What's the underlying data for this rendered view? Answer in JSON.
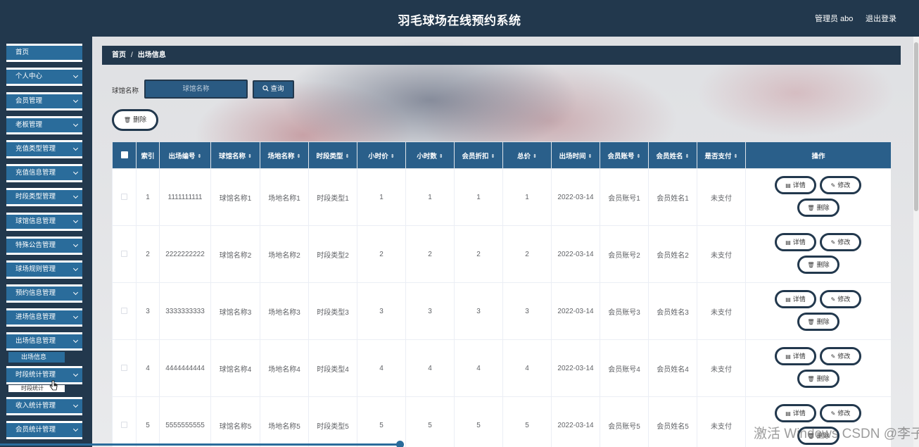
{
  "header": {
    "title": "羽毛球场在线预约系统",
    "admin": "管理员 abo",
    "logout": "退出登录"
  },
  "sidebar": {
    "items": [
      {
        "label": "首页",
        "chevron": false
      },
      {
        "label": "个人中心",
        "chevron": true
      },
      {
        "label": "会员管理",
        "chevron": true
      },
      {
        "label": "老板管理",
        "chevron": true
      },
      {
        "label": "充值类型管理",
        "chevron": true
      },
      {
        "label": "充值信息管理",
        "chevron": true
      },
      {
        "label": "时段类型管理",
        "chevron": true
      },
      {
        "label": "球馆信息管理",
        "chevron": true
      },
      {
        "label": "特殊公告管理",
        "chevron": true
      },
      {
        "label": "球场规则管理",
        "chevron": true
      },
      {
        "label": "预约信息管理",
        "chevron": true
      },
      {
        "label": "进场信息管理",
        "chevron": true
      },
      {
        "label": "出场信息管理",
        "chevron": true
      },
      {
        "label": "时段统计管理",
        "chevron": true
      },
      {
        "label": "收入统计管理",
        "chevron": true
      },
      {
        "label": "会员统计管理",
        "chevron": true
      }
    ],
    "submenu_active": "出场信息",
    "submenu_hover": "时段统计"
  },
  "breadcrumb": {
    "home": "首页",
    "separator": "/",
    "current": "出场信息"
  },
  "search": {
    "label": "球馆名称",
    "placeholder": "球馆名称",
    "query_label": "查询"
  },
  "toolbar": {
    "delete_label": "删除"
  },
  "table": {
    "headers": [
      "索引",
      "出场编号",
      "球馆名称",
      "场地名称",
      "时段类型",
      "小时价",
      "小时数",
      "会员折扣",
      "总价",
      "出场时间",
      "会员账号",
      "会员姓名",
      "是否支付",
      "操作"
    ],
    "rows": [
      [
        "1",
        "1111111111",
        "球馆名称1",
        "场地名称1",
        "时段类型1",
        "1",
        "1",
        "1",
        "1",
        "2022-03-14",
        "会员账号1",
        "会员姓名1",
        "未支付"
      ],
      [
        "2",
        "2222222222",
        "球馆名称2",
        "场地名称2",
        "时段类型2",
        "2",
        "2",
        "2",
        "2",
        "2022-03-14",
        "会员账号2",
        "会员姓名2",
        "未支付"
      ],
      [
        "3",
        "3333333333",
        "球馆名称3",
        "场地名称3",
        "时段类型3",
        "3",
        "3",
        "3",
        "3",
        "2022-03-14",
        "会员账号3",
        "会员姓名3",
        "未支付"
      ],
      [
        "4",
        "4444444444",
        "球馆名称4",
        "场地名称4",
        "时段类型4",
        "4",
        "4",
        "4",
        "4",
        "2022-03-14",
        "会员账号4",
        "会员姓名4",
        "未支付"
      ],
      [
        "5",
        "5555555555",
        "球馆名称5",
        "场地名称5",
        "时段类型5",
        "5",
        "5",
        "5",
        "5",
        "2022-03-14",
        "会员账号5",
        "会员姓名5",
        "未支付"
      ]
    ],
    "actions": {
      "detail": "详情",
      "edit": "修改",
      "delete": "删除"
    }
  },
  "watermark": "激活 Windows CSDN @李子c"
}
